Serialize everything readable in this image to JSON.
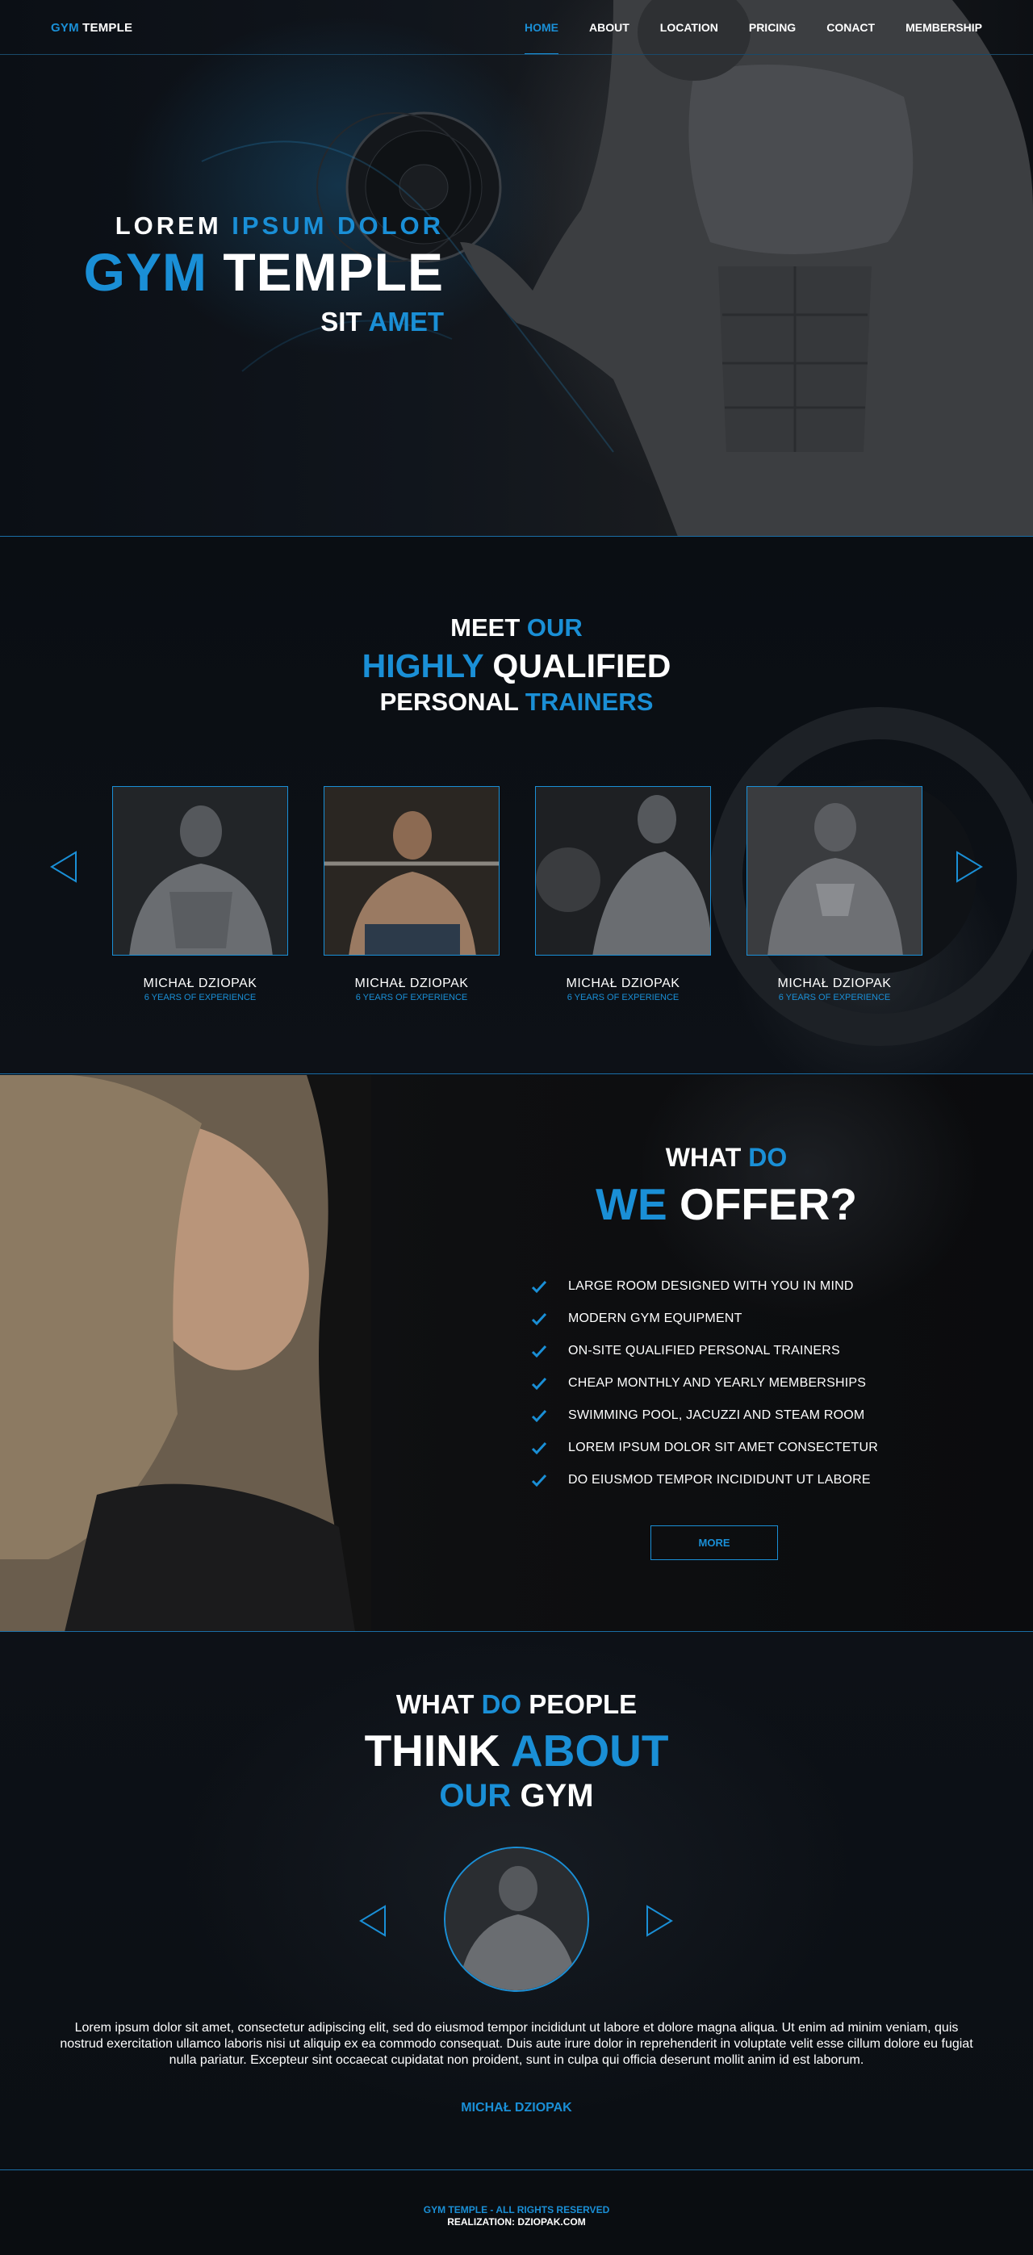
{
  "nav": {
    "logo_part1": "GYM",
    "logo_part2": "TEMPLE",
    "items": [
      "HOME",
      "ABOUT",
      "LOCATION",
      "PRICING",
      "CONACT",
      "MEMBERSHIP"
    ],
    "active": "HOME"
  },
  "hero": {
    "line1_a": "LOREM",
    "line1_b": "IPSUM DOLOR",
    "line2_a": "GYM",
    "line2_b": "TEMPLE",
    "line3_a": "SIT",
    "line3_b": "AMET"
  },
  "trainers": {
    "title1_a": "MEET",
    "title1_b": "OUR",
    "title2_a": "HIGHLY",
    "title2_b": "QUALIFIED",
    "title3_a": "PERSONAL",
    "title3_b": "TRAINERS",
    "cards": [
      {
        "name": "MICHAŁ DZIOPAK",
        "experience": "6 YEARS OF EXPERIENCE"
      },
      {
        "name": "MICHAŁ DZIOPAK",
        "experience": "6 YEARS OF EXPERIENCE"
      },
      {
        "name": "MICHAŁ DZIOPAK",
        "experience": "6 YEARS OF EXPERIENCE"
      },
      {
        "name": "MICHAŁ DZIOPAK",
        "experience": "6 YEARS OF EXPERIENCE"
      }
    ]
  },
  "offer": {
    "title1_a": "WHAT",
    "title1_b": "DO",
    "title2_a": "WE",
    "title2_b": "OFFER?",
    "items": [
      "LARGE ROOM DESIGNED WITH YOU IN MIND",
      "MODERN GYM EQUIPMENT",
      "ON-SITE QUALIFIED PERSONAL TRAINERS",
      "CHEAP MONTHLY AND YEARLY MEMBERSHIPS",
      "SWIMMING POOL, JACUZZI AND STEAM ROOM",
      "LOREM IPSUM DOLOR SIT AMET CONSECTETUR",
      "DO EIUSMOD TEMPOR INCIDIDUNT UT LABORE"
    ],
    "button": "MORE"
  },
  "testimonial": {
    "title1_a": "WHAT",
    "title1_b": "DO",
    "title1_c": "PEOPLE",
    "title2_a": "THINK",
    "title2_b": "ABOUT",
    "title3_a": "OUR",
    "title3_b": "GYM",
    "quote": "Lorem ipsum dolor sit amet, consectetur adipiscing elit, sed do eiusmod tempor incididunt ut labore et dolore magna aliqua. Ut enim ad minim veniam, quis nostrud exercitation ullamco laboris nisi ut aliquip ex ea commodo consequat. Duis aute irure dolor in reprehenderit in voluptate velit esse cillum dolore eu fugiat nulla pariatur. Excepteur sint occaecat cupidatat non proident, sunt in culpa qui officia deserunt mollit anim id est laborum.",
    "author": "MICHAŁ DZIOPAK"
  },
  "footer": {
    "line1": "GYM TEMPLE - ALL RIGHTS RESERVED",
    "line2": "REALIZATION: DZIOPAK.COM"
  },
  "colors": {
    "accent": "#1a8fd6",
    "background": "#0b0f15",
    "text": "#ffffff"
  }
}
